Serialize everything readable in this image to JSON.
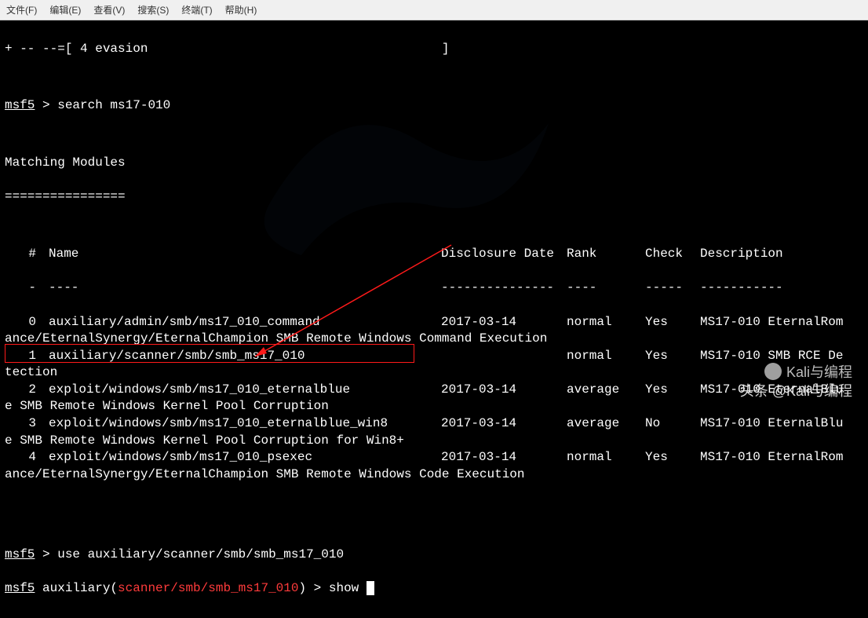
{
  "menubar": [
    "文件(F)",
    "编辑(E)",
    "查看(V)",
    "搜索(S)",
    "终端(T)",
    "帮助(H)"
  ],
  "header_line": "+ -- --=[ 4 evasion                                       ]",
  "prompt1": "msf5",
  "cmd1": "search ms17-010",
  "section_title": "Matching Modules",
  "section_underline": "================",
  "columns": {
    "idx": "#",
    "name": "Name",
    "date": "Disclosure Date",
    "rank": "Rank",
    "check": "Check",
    "desc": "Description"
  },
  "col_under": {
    "idx": "-",
    "name": "----",
    "date": "---------------",
    "rank": "----",
    "check": "-----",
    "desc": "-----------"
  },
  "rows": [
    {
      "idx": "0",
      "name": "auxiliary/admin/smb/ms17_010_command",
      "date": "2017-03-14",
      "rank": "normal",
      "check": "Yes",
      "desc1": "MS17-010 EternalRom",
      "desc2": "ance/EternalSynergy/EternalChampion SMB Remote Windows Command Execution"
    },
    {
      "idx": "1",
      "name": "auxiliary/scanner/smb/smb_ms17_010",
      "date": "",
      "rank": "normal",
      "check": "Yes",
      "desc1": "MS17-010 SMB RCE De",
      "desc2": "tection"
    },
    {
      "idx": "2",
      "name": "exploit/windows/smb/ms17_010_eternalblue",
      "date": "2017-03-14",
      "rank": "average",
      "check": "Yes",
      "desc1": "MS17-010 EternalBlu",
      "desc2": "e SMB Remote Windows Kernel Pool Corruption"
    },
    {
      "idx": "3",
      "name": "exploit/windows/smb/ms17_010_eternalblue_win8",
      "date": "2017-03-14",
      "rank": "average",
      "check": "No",
      "desc1": "MS17-010 EternalBlu",
      "desc2": "e SMB Remote Windows Kernel Pool Corruption for Win8+"
    },
    {
      "idx": "4",
      "name": "exploit/windows/smb/ms17_010_psexec",
      "date": "2017-03-14",
      "rank": "normal",
      "check": "Yes",
      "desc1": "MS17-010 EternalRom",
      "desc2": "ance/EternalSynergy/EternalChampion SMB Remote Windows Code Execution"
    }
  ],
  "prompt2": "msf5",
  "cmd2": "use auxiliary/scanner/smb/smb_ms17_010",
  "prompt3": "msf5",
  "context3": "auxiliary(",
  "context3_mod": "scanner/smb/smb_ms17_010",
  "context3_close": ") > ",
  "cmd3": "show ",
  "watermark1": "Kali与编程",
  "watermark2": "头条 @Kali与编程"
}
